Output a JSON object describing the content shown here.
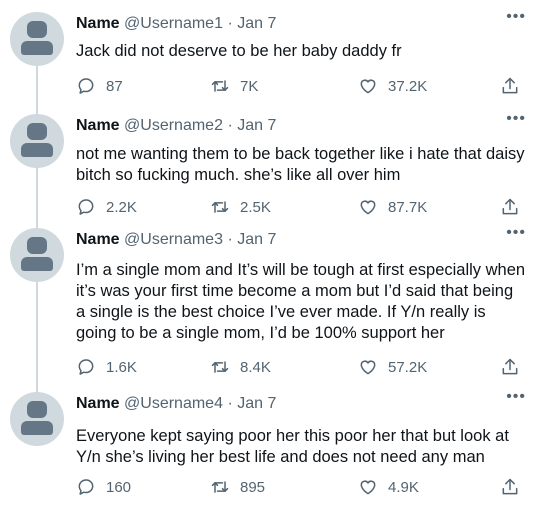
{
  "tweets": [
    {
      "name": "Name",
      "handle": "@Username1",
      "dot": "·",
      "date": "Jan 7",
      "text": "Jack did not deserve to be her baby daddy fr",
      "replies": "87",
      "retweets": "7K",
      "likes": "37.2K"
    },
    {
      "name": "Name",
      "handle": "@Username2",
      "dot": "·",
      "date": "Jan 7",
      "text": "not me wanting them to be back together like i hate that daisy bitch so fucking much. she’s like all over him",
      "replies": "2.2K",
      "retweets": "2.5K",
      "likes": "87.7K"
    },
    {
      "name": "Name",
      "handle": "@Username3",
      "dot": "·",
      "date": "Jan 7",
      "text": "I’m a single mom and It’s will be tough at first especially when it’s was your first time become a mom but I’d said that being a single is the best choice I’ve ever made. If Y/n really is going to be a single mom, I’d be 100% support her",
      "replies": "1.6K",
      "retweets": "8.4K",
      "likes": "57.2K"
    },
    {
      "name": "Name",
      "handle": "@Username4",
      "dot": "·",
      "date": "Jan 7",
      "text": "Everyone kept saying poor her this poor her that but look at Y/n she’s living her best life and does not need any man",
      "replies": "160",
      "retweets": "895",
      "likes": "4.9K"
    }
  ],
  "icons": {
    "more": "more-horizontal-icon",
    "reply": "reply-bubble-icon",
    "retweet": "retweet-icon",
    "like": "heart-icon",
    "share": "share-icon"
  },
  "colors": {
    "text": "#0f1419",
    "secondary": "#536471",
    "avatar_bg": "#cfd9de",
    "avatar_fg": "#657786",
    "thread_line": "#cfd9de"
  }
}
